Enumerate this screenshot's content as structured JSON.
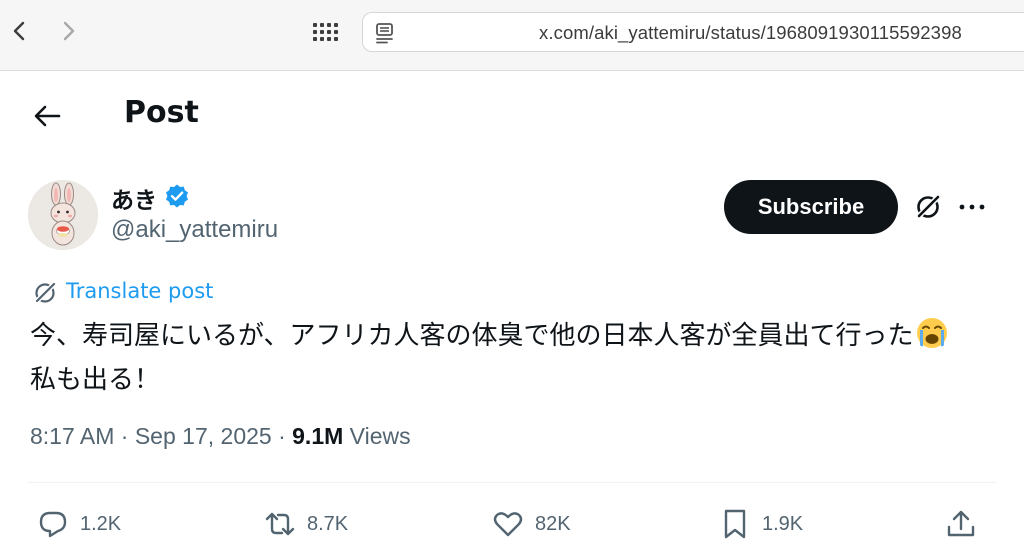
{
  "browser": {
    "url": "x.com/aki_yattemiru/status/1968091930115592398",
    "back_icon": "chevron-left-icon",
    "forward_icon": "chevron-right-icon",
    "tabs_icon": "grid-dots-icon",
    "reader_icon": "reader-icon"
  },
  "header": {
    "title": "Post",
    "back_icon": "arrow-left-icon"
  },
  "author": {
    "display_name": "あき",
    "handle": "@aki_yattemiru",
    "verified": true,
    "verified_color": "#1d9bf0",
    "avatar": "bunny-avatar"
  },
  "actions_top": {
    "subscribe_label": "Subscribe",
    "grok_icon": "grok-icon",
    "more_icon": "more-dots-icon"
  },
  "post": {
    "translate_label": "Translate post",
    "translate_color": "#1d9bf0",
    "text_line1": "今、寿司屋にいるが、アフリカ人客の体臭で他の日本人客が全員出て行った",
    "text_emoji": "loudly-crying-face",
    "text_line2": "私も出る！",
    "time": "8:17 AM",
    "date": "Sep 17, 2025",
    "views_count": "9.1M",
    "views_label": "Views"
  },
  "engagement": {
    "replies": "1.2K",
    "reposts": "8.7K",
    "likes": "82K",
    "bookmarks": "1.9K"
  },
  "colors": {
    "text_primary": "#0f1419",
    "text_secondary": "#536471",
    "button_dark": "#0f1419"
  }
}
